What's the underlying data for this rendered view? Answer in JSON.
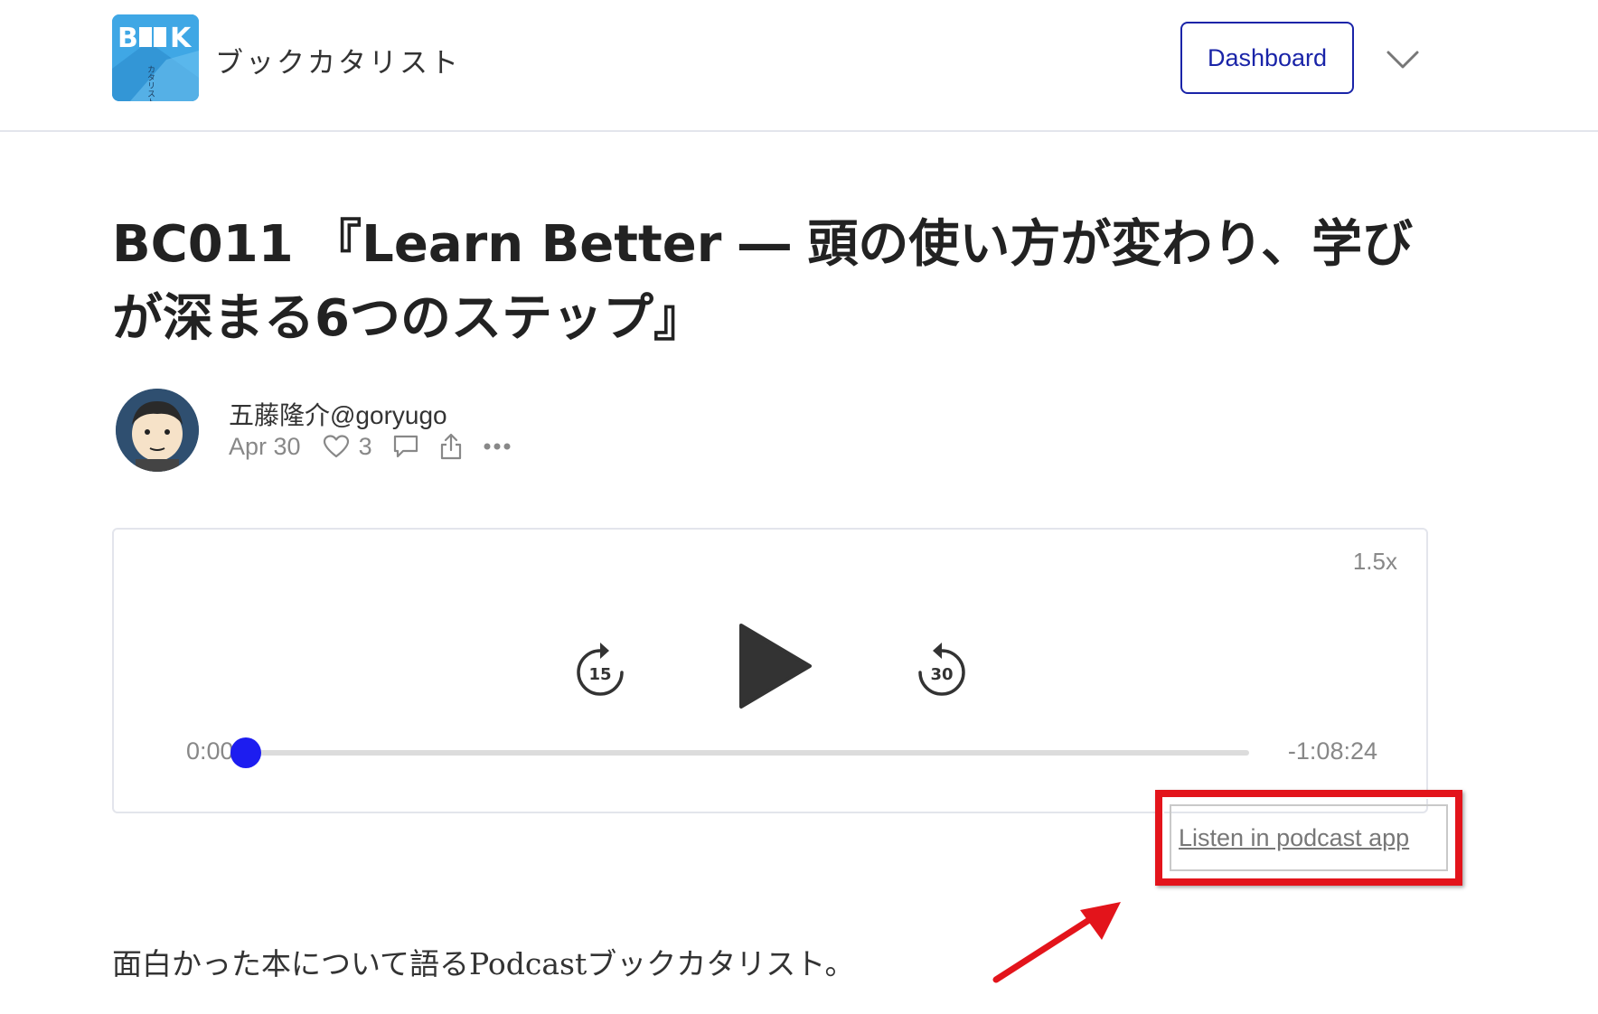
{
  "header": {
    "logo_text": "BOOK カタリスト",
    "publication_name": "ブックカタリスト",
    "dashboard_label": "Dashboard"
  },
  "post": {
    "title": "BC011 『Learn Better ― 頭の使い方が変わり、学びが深まる6つのステップ』",
    "author": "五藤隆介@goryugo",
    "date": "Apr 30",
    "like_count": "3"
  },
  "player": {
    "speed": "1.5x",
    "skip_back_label": "15",
    "skip_forward_label": "30",
    "current_time": "0:00",
    "remaining_time": "-1:08:24",
    "progress": 0.0,
    "accent_color": "#1d1df0"
  },
  "listen_link": "Listen in podcast app",
  "annotation": {
    "highlight_color": "#e3141b"
  },
  "body": {
    "first_line": "面白かった本について語るPodcastブックカタリスト。"
  }
}
